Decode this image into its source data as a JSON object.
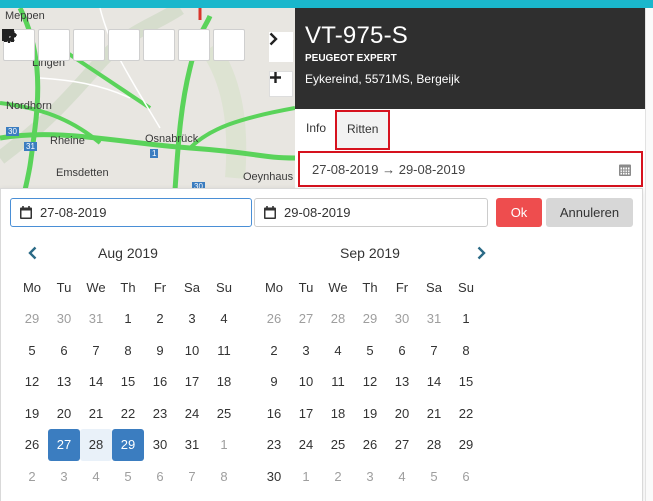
{
  "colors": {
    "accent": "#1ab7cc",
    "header_bg": "#2f2f2f",
    "highlight": "#d6121e",
    "selected": "#3b7dc0",
    "ok": "#ee4d4e"
  },
  "map": {
    "cities": [
      "Meppen",
      "Lingen",
      "Nordhorn",
      "Rheine",
      "Osnabrück",
      "Emsdetten",
      "Oeynhaus"
    ],
    "road_labels": [
      "30",
      "31",
      "1",
      "30"
    ],
    "toolbar": [
      "crosshair-icon",
      "grid-icon",
      "eye-icon",
      "home-icon",
      "gear-icon",
      "plus-icon",
      "minus-icon"
    ],
    "expand_icon": "chevron-right-icon",
    "side_icon": "plus-icon"
  },
  "vehicle": {
    "plate": "VT-975-S",
    "model": "PEUGEOT EXPERT",
    "address": "Eykereind, 5571MS, Bergeijk"
  },
  "tabs": [
    "Info",
    "Ritten"
  ],
  "range": {
    "text": "27-08-2019 → 29-08-2019"
  },
  "picker": {
    "start": "27-08-2019",
    "end": "29-08-2019",
    "ok_label": "Ok",
    "cancel_label": "Annuleren",
    "weekdays": [
      "Mo",
      "Tu",
      "We",
      "Th",
      "Fr",
      "Sa",
      "Su"
    ],
    "months": [
      {
        "title": "Aug 2019",
        "weeks": [
          [
            [
              "29",
              1
            ],
            [
              "30",
              1
            ],
            [
              "31",
              1
            ],
            [
              "1",
              0
            ],
            [
              "2",
              0
            ],
            [
              "3",
              0
            ],
            [
              "4",
              0
            ]
          ],
          [
            [
              "5",
              0
            ],
            [
              "6",
              0
            ],
            [
              "7",
              0
            ],
            [
              "8",
              0
            ],
            [
              "9",
              0
            ],
            [
              "10",
              0
            ],
            [
              "11",
              0
            ]
          ],
          [
            [
              "12",
              0
            ],
            [
              "13",
              0
            ],
            [
              "14",
              0
            ],
            [
              "15",
              0
            ],
            [
              "16",
              0
            ],
            [
              "17",
              0
            ],
            [
              "18",
              0
            ]
          ],
          [
            [
              "19",
              0
            ],
            [
              "20",
              0
            ],
            [
              "21",
              0
            ],
            [
              "22",
              0
            ],
            [
              "23",
              0
            ],
            [
              "24",
              0
            ],
            [
              "25",
              0
            ]
          ],
          [
            [
              "26",
              0
            ],
            [
              "27",
              2
            ],
            [
              "28",
              3
            ],
            [
              "29",
              2
            ],
            [
              "30",
              0
            ],
            [
              "31",
              0
            ],
            [
              "1",
              1
            ]
          ],
          [
            [
              "2",
              1
            ],
            [
              "3",
              1
            ],
            [
              "4",
              1
            ],
            [
              "5",
              1
            ],
            [
              "6",
              1
            ],
            [
              "7",
              1
            ],
            [
              "8",
              1
            ]
          ]
        ]
      },
      {
        "title": "Sep 2019",
        "weeks": [
          [
            [
              "26",
              1
            ],
            [
              "27",
              1
            ],
            [
              "28",
              1
            ],
            [
              "29",
              1
            ],
            [
              "30",
              1
            ],
            [
              "31",
              1
            ],
            [
              "1",
              0
            ]
          ],
          [
            [
              "2",
              0
            ],
            [
              "3",
              0
            ],
            [
              "4",
              0
            ],
            [
              "5",
              0
            ],
            [
              "6",
              0
            ],
            [
              "7",
              0
            ],
            [
              "8",
              0
            ]
          ],
          [
            [
              "9",
              0
            ],
            [
              "10",
              0
            ],
            [
              "11",
              0
            ],
            [
              "12",
              0
            ],
            [
              "13",
              0
            ],
            [
              "14",
              0
            ],
            [
              "15",
              0
            ]
          ],
          [
            [
              "16",
              0
            ],
            [
              "17",
              0
            ],
            [
              "18",
              0
            ],
            [
              "19",
              0
            ],
            [
              "20",
              0
            ],
            [
              "21",
              0
            ],
            [
              "22",
              0
            ]
          ],
          [
            [
              "23",
              0
            ],
            [
              "24",
              0
            ],
            [
              "25",
              0
            ],
            [
              "26",
              0
            ],
            [
              "27",
              0
            ],
            [
              "28",
              0
            ],
            [
              "29",
              0
            ]
          ],
          [
            [
              "30",
              0
            ],
            [
              "1",
              1
            ],
            [
              "2",
              1
            ],
            [
              "3",
              1
            ],
            [
              "4",
              1
            ],
            [
              "5",
              1
            ],
            [
              "6",
              1
            ]
          ]
        ]
      }
    ]
  }
}
